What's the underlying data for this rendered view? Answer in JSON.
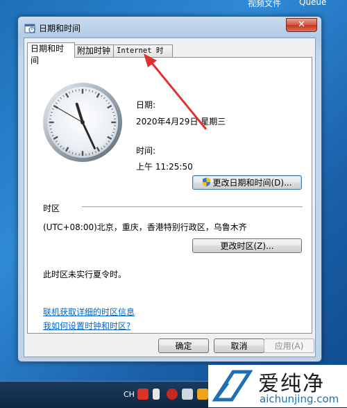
{
  "desktop": {
    "top_texts": [
      "视频文件",
      "Queue"
    ]
  },
  "window": {
    "title": "日期和时间",
    "close_glyph": "✕",
    "tabs": [
      {
        "label": "日期和时间"
      },
      {
        "label": "附加时钟"
      },
      {
        "label": "Internet 时间"
      }
    ],
    "date_label": "日期:",
    "date_value": "2020年4月29日 星期三",
    "time_label": "时间:",
    "time_value": "上午 11:25:50",
    "change_datetime_button": "更改日期和时间(D)...",
    "timezone_heading": "时区",
    "timezone_value": "(UTC+08:00)北京，重庆，香港特别行政区，乌鲁木齐",
    "change_timezone_button": "更改时区(Z)...",
    "dst_note": "此时区未实行夏令时。",
    "link_timezone_info": "联机获取详细的时区信息",
    "link_how_to_set": "我如何设置时钟和时区?",
    "ok_button": "确定",
    "cancel_button": "取消",
    "apply_button": "应用(A)"
  },
  "clock": {
    "hours": 11,
    "minutes": 25,
    "seconds": 50
  },
  "taskbar": {
    "lang": "CH"
  },
  "watermark": {
    "brand": "爱纯净",
    "url": "aichunjing.com"
  },
  "colors": {
    "accent": "#0066cc",
    "arrow": "#e0322d",
    "close": "#c3361f"
  }
}
